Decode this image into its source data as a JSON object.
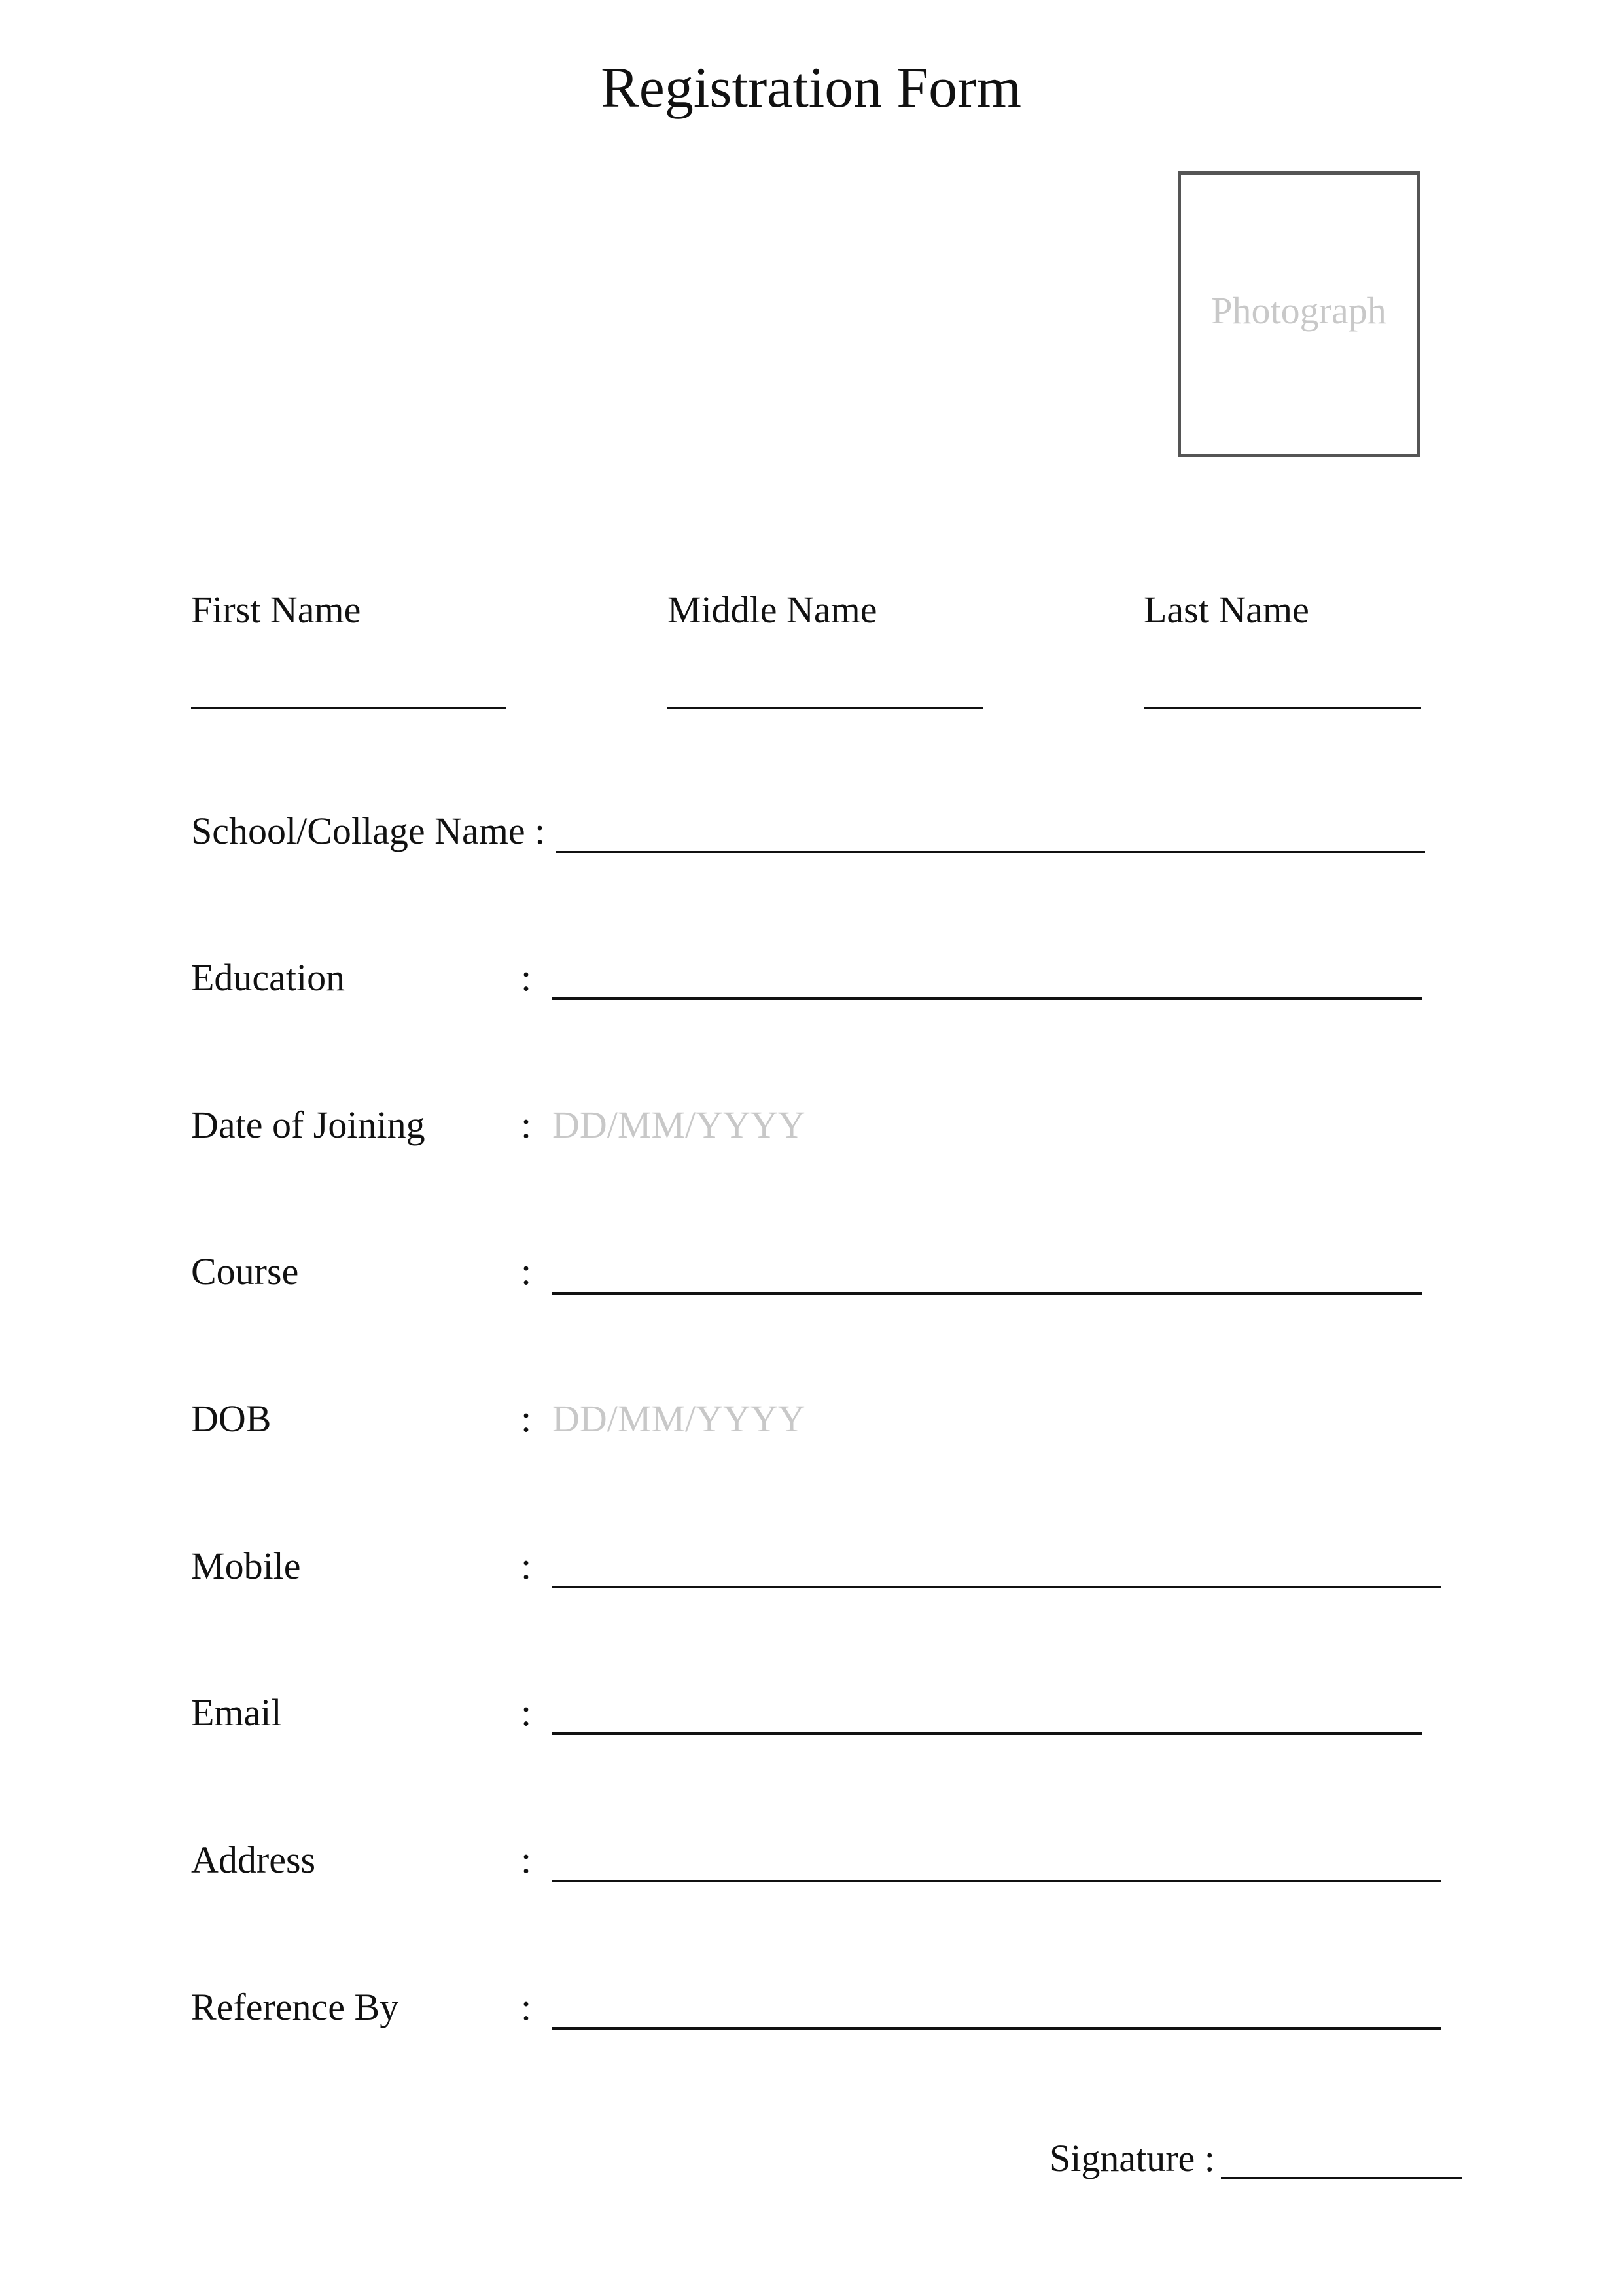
{
  "form": {
    "title": "Registration Form",
    "photo_placeholder": "Photograph"
  },
  "name_fields": {
    "first_label": "First Name",
    "middle_label": "Middle Name",
    "last_label": "Last Name"
  },
  "rows": {
    "school": {
      "label": "School/Collage Name :"
    },
    "education": {
      "label": "Education",
      "colon": ":"
    },
    "date_of_joining": {
      "label": "Date of Joining",
      "colon": ":",
      "placeholder": "DD/MM/YYYY"
    },
    "course": {
      "label": "Course",
      "colon": ":"
    },
    "dob": {
      "label": "DOB",
      "colon": ":",
      "placeholder": "DD/MM/YYYY"
    },
    "mobile": {
      "label": "Mobile",
      "colon": ":"
    },
    "email": {
      "label": "Email",
      "colon": ":"
    },
    "address": {
      "label": "Address",
      "colon": ":"
    },
    "reference_by": {
      "label": "Reference By",
      "colon": ":"
    }
  },
  "signature": {
    "label": "Signature :"
  }
}
